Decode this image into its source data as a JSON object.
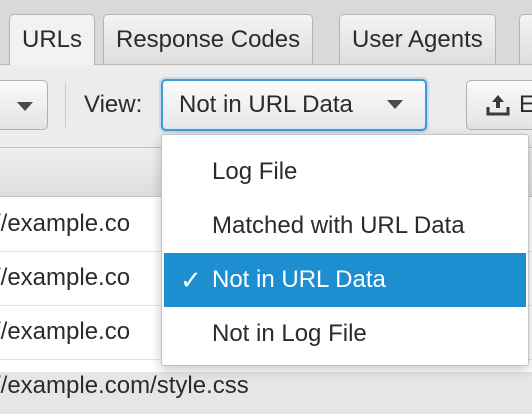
{
  "tabs": [
    {
      "label": "URLs",
      "active": true
    },
    {
      "label": "Response Codes",
      "active": false
    },
    {
      "label": "User Agents",
      "active": false
    }
  ],
  "toolbar": {
    "view_label": "View:",
    "view_selected": "Not in URL Data",
    "export_label": "E"
  },
  "table": {
    "rows": [
      "//example.co",
      "//example.co",
      "//example.co",
      "//example.com/style.css"
    ]
  },
  "view_menu": {
    "items": [
      {
        "label": "Log File",
        "selected": false
      },
      {
        "label": "Matched with URL Data",
        "selected": false
      },
      {
        "label": "Not in URL Data",
        "selected": true
      },
      {
        "label": "Not in Log File",
        "selected": false
      }
    ],
    "check_glyph": "✓"
  },
  "colors": {
    "accent": "#1d8fd0",
    "focus_ring": "#3d9bd6"
  }
}
